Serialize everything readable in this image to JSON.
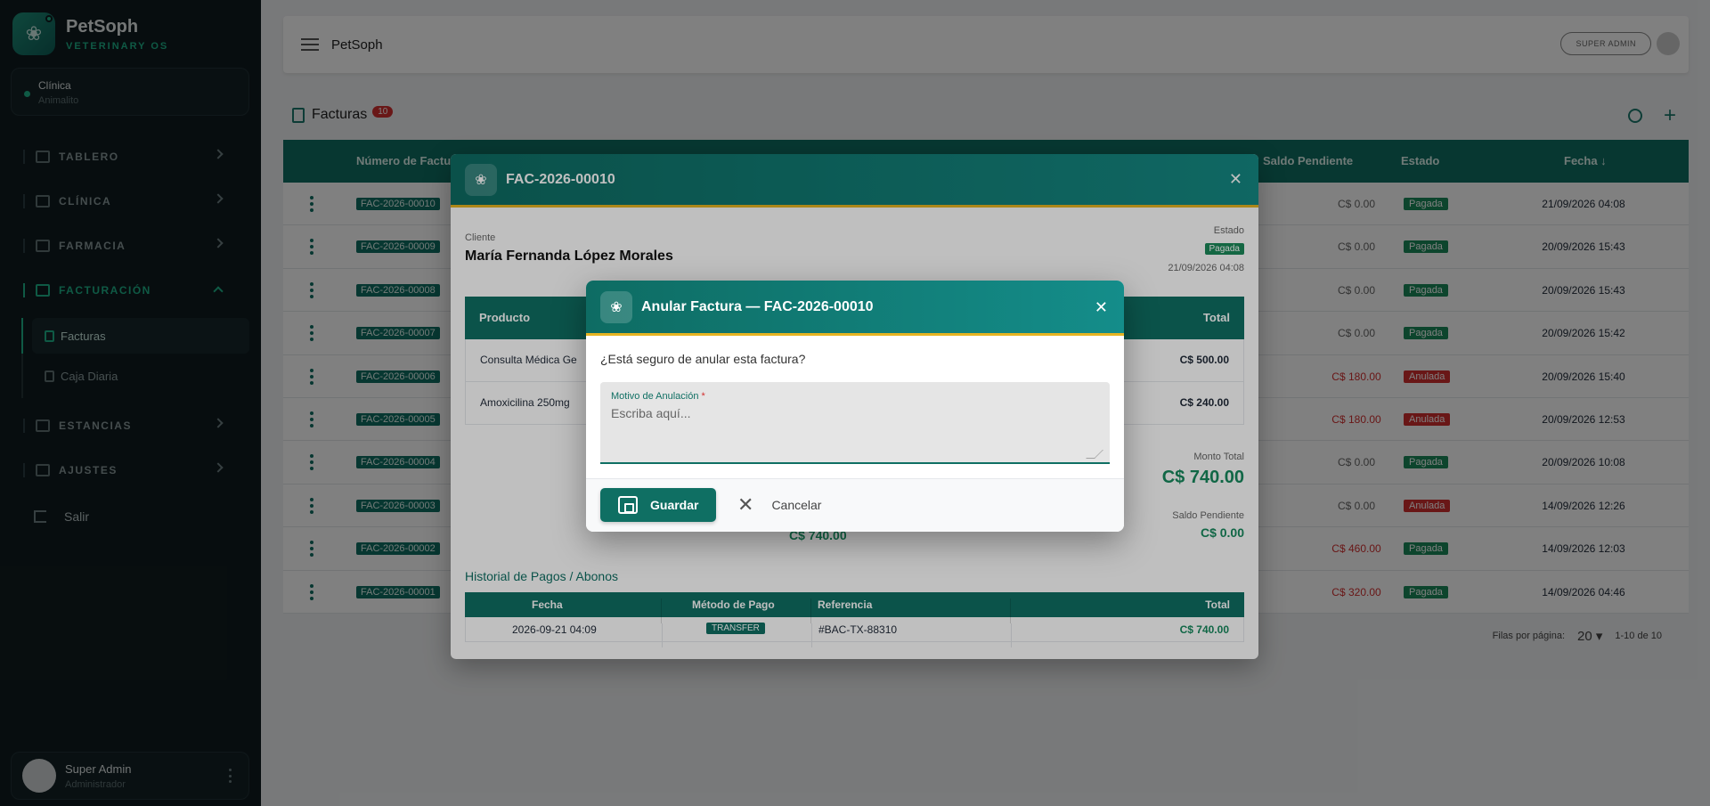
{
  "sidebar": {
    "brand_name": "PetSoph",
    "brand_sub": "VETERINARY OS",
    "clinic_label": "Clínica",
    "clinic_name": "Animalito",
    "nav": [
      "TABLERO",
      "CLÍNICA",
      "FARMACIA",
      "FACTURACIÓN",
      "ESTANCIAS",
      "AJUSTES"
    ],
    "sub_items": [
      "Facturas",
      "Caja Diaria"
    ],
    "logout": "Salir",
    "user_name": "Super Admin",
    "user_role": "Administrador"
  },
  "topbar": {
    "title": "PetSoph",
    "role_chip": "SUPER ADMIN"
  },
  "list": {
    "title": "Facturas",
    "count": "10",
    "columns": {
      "numero": "Número de Factura",
      "saldo": "Saldo Pendiente",
      "estado": "Estado",
      "fecha": "Fecha ↓"
    },
    "rows": [
      {
        "num": "FAC-2026-00010",
        "saldo": "C$ 0.00",
        "estado": "Pagada",
        "fecha": "21/09/2026 04:08"
      },
      {
        "num": "FAC-2026-00009",
        "saldo": "C$ 0.00",
        "estado": "Pagada",
        "fecha": "20/09/2026 15:43"
      },
      {
        "num": "FAC-2026-00008",
        "saldo": "C$ 0.00",
        "estado": "Pagada",
        "fecha": "20/09/2026 15:43"
      },
      {
        "num": "FAC-2026-00007",
        "saldo": "C$ 0.00",
        "estado": "Pagada",
        "fecha": "20/09/2026 15:42"
      },
      {
        "num": "FAC-2026-00006",
        "saldo": "C$ 180.00",
        "estado": "Anulada",
        "fecha": "20/09/2026 15:40"
      },
      {
        "num": "FAC-2026-00005",
        "saldo": "C$ 180.00",
        "estado": "Anulada",
        "fecha": "20/09/2026 12:53"
      },
      {
        "num": "FAC-2026-00004",
        "saldo": "C$ 0.00",
        "estado": "Pagada",
        "fecha": "20/09/2026 10:08"
      },
      {
        "num": "FAC-2026-00003",
        "saldo": "C$ 0.00",
        "estado": "Anulada",
        "fecha": "14/09/2026 12:26"
      },
      {
        "num": "FAC-2026-00002",
        "saldo": "C$ 460.00",
        "estado": "Pagada",
        "fecha": "14/09/2026 12:03"
      },
      {
        "num": "FAC-2026-00001",
        "saldo": "C$ 320.00",
        "estado": "Pagada",
        "fecha": "14/09/2026 04:46"
      }
    ],
    "rows_per_page_label": "Filas por página:",
    "rows_per_page": "20",
    "range": "1-10 de 10"
  },
  "invoice": {
    "title": "FAC-2026-00010",
    "cliente_label": "Cliente",
    "cliente_name": "María Fernanda López Morales",
    "estado_label": "Estado",
    "estado": "Pagada",
    "date": "21/09/2026 04:08",
    "col_producto": "Producto",
    "col_total": "Total",
    "products": [
      {
        "name": "Consulta Médica Ge",
        "total": "C$ 500.00"
      },
      {
        "name": "Amoxicilina 250mg",
        "total": "C$ 240.00"
      }
    ],
    "monto_label": "Monto Total",
    "monto": "C$ 740.00",
    "mid_value": "C$ 740.00",
    "saldo_label": "Saldo Pendiente",
    "saldo": "C$ 0.00",
    "hist_title": "Historial de Pagos / Abonos",
    "hist_cols": [
      "Fecha",
      "Método de Pago",
      "Referencia",
      "Total"
    ],
    "hist_row": {
      "fecha": "2026-09-21 04:09",
      "metodo": "TRANSFER",
      "ref": "#BAC-TX-88310",
      "total": "C$ 740.00"
    }
  },
  "dialog": {
    "title": "Anular Factura — FAC-2026-00010",
    "question": "¿Está seguro de anular esta factura?",
    "field_label": "Motivo de Anulación",
    "field_required": "*",
    "placeholder": "Escriba aquí...",
    "save": "Guardar",
    "cancel": "Cancelar"
  },
  "colors": {
    "primary": "#0f6f63",
    "accent": "#e6b422",
    "paid": "#1b8a5a",
    "void": "#d32f2f"
  }
}
